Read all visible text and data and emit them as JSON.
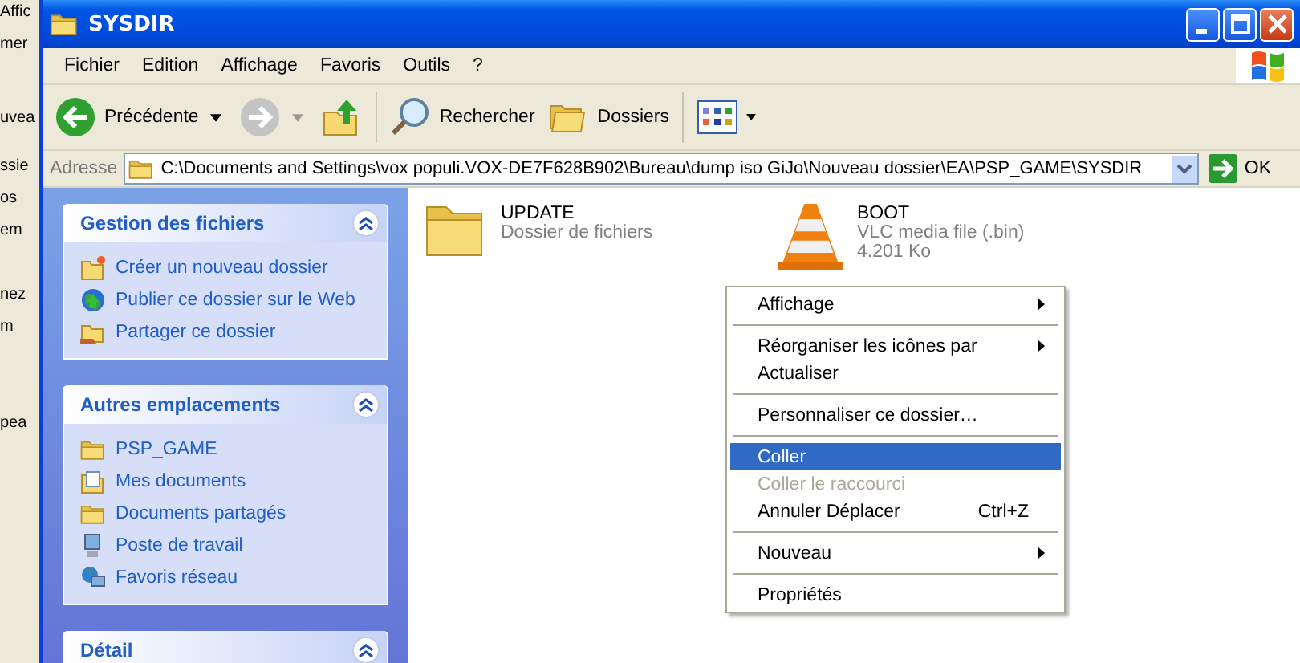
{
  "background_window": {
    "fragments": [
      "Affic",
      "mer",
      "uvea",
      "ssie",
      "os",
      "em",
      "nez",
      "m",
      "pea"
    ]
  },
  "window": {
    "title": "SYSDIR"
  },
  "menu_bar": [
    "Fichier",
    "Edition",
    "Affichage",
    "Favoris",
    "Outils",
    "?"
  ],
  "toolbar": {
    "back": {
      "label": "Précédente",
      "disabled": false
    },
    "forward": {
      "disabled": true
    },
    "search": "Rechercher",
    "folders": "Dossiers"
  },
  "address_bar": {
    "label": "Adresse",
    "value": "C:\\Documents and Settings\\vox populi.VOX-DE7F628B902\\Bureau\\dump iso GiJo\\Nouveau dossier\\EA\\PSP_GAME\\SYSDIR",
    "go": "OK"
  },
  "task_pane": [
    {
      "title": "Gestion des fichiers",
      "items": [
        {
          "kind": "newfolder",
          "label": "Créer un nouveau dossier"
        },
        {
          "kind": "web",
          "label": "Publier ce dossier sur le Web"
        },
        {
          "kind": "share",
          "label": "Partager ce dossier"
        }
      ]
    },
    {
      "title": "Autres emplacements",
      "items": [
        {
          "kind": "folder",
          "label": "PSP_GAME"
        },
        {
          "kind": "docs",
          "label": "Mes documents"
        },
        {
          "kind": "folder",
          "label": "Documents partagés"
        },
        {
          "kind": "computer",
          "label": "Poste de travail"
        },
        {
          "kind": "network",
          "label": "Favoris réseau"
        }
      ]
    },
    {
      "title": "Détail"
    }
  ],
  "files": [
    {
      "kind": "folder",
      "name": "UPDATE",
      "lines": [
        "Dossier de fichiers"
      ]
    },
    {
      "kind": "media",
      "name": "BOOT",
      "lines": [
        "VLC media file (.bin)",
        "4.201 Ko"
      ]
    }
  ],
  "context_menu": [
    {
      "kind": "item",
      "label": "Affichage",
      "submenu": true,
      "selected": false,
      "disabled": false
    },
    {
      "kind": "separator"
    },
    {
      "kind": "item",
      "label": "Réorganiser les icônes par",
      "submenu": true,
      "selected": false,
      "disabled": false
    },
    {
      "kind": "item",
      "label": "Actualiser",
      "submenu": false,
      "selected": false,
      "disabled": false
    },
    {
      "kind": "separator"
    },
    {
      "kind": "item",
      "label": "Personnaliser ce dossier…",
      "submenu": false,
      "selected": false,
      "disabled": false
    },
    {
      "kind": "separator"
    },
    {
      "kind": "item",
      "label": "Coller",
      "submenu": false,
      "selected": true,
      "disabled": false
    },
    {
      "kind": "item",
      "label": "Coller le raccourci",
      "submenu": false,
      "selected": false,
      "disabled": true
    },
    {
      "kind": "item",
      "label": "Annuler Déplacer",
      "shortcut": "Ctrl+Z",
      "submenu": false,
      "selected": false,
      "disabled": false
    },
    {
      "kind": "separator"
    },
    {
      "kind": "item",
      "label": "Nouveau",
      "submenu": true,
      "selected": false,
      "disabled": false
    },
    {
      "kind": "separator"
    },
    {
      "kind": "item",
      "label": "Propriétés",
      "submenu": false,
      "selected": false,
      "disabled": false
    }
  ]
}
